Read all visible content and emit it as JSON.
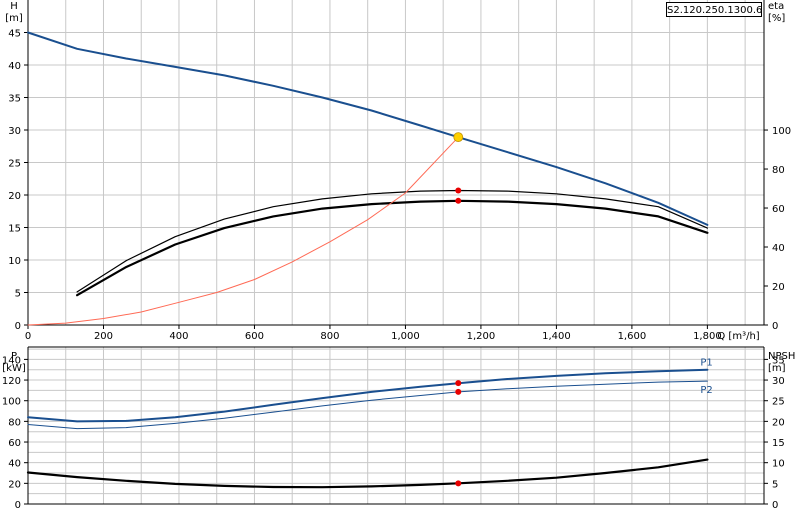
{
  "pump_label": "S2.120.250.1300.6.",
  "colors": {
    "curve_blue": "#1a4f8f",
    "red_curve": "#ff6a55",
    "grid": "#c8c8c8",
    "marker_red": "#e80000",
    "marker_yellow": "#ffd000"
  },
  "chart_data": [
    {
      "type": "line",
      "id": "head-efficiency",
      "ylabel_left": [
        "H",
        "[m]"
      ],
      "ylabel_right": [
        "eta",
        "[%]"
      ],
      "xlabel": "Q [m³/h]",
      "xlim": [
        0,
        1950
      ],
      "ylim_left": [
        0,
        50
      ],
      "ylim_right": [
        0,
        166.7
      ],
      "x_ticks": [
        0,
        200,
        400,
        600,
        800,
        1000,
        1200,
        1400,
        1600,
        1800
      ],
      "x_tick_labels": [
        "0",
        "200",
        "400",
        "600",
        "800",
        "1,000",
        "1,200",
        "1,400",
        "1,600",
        "1,800"
      ],
      "y_ticks_left": [
        0,
        5,
        10,
        15,
        20,
        25,
        30,
        35,
        40,
        45
      ],
      "y_ticks_right": [
        0,
        20,
        40,
        60,
        80,
        100
      ],
      "grid": true,
      "series": [
        {
          "axis": "left",
          "color": "#1a4f8f",
          "width": 2,
          "x": [
            0,
            130,
            260,
            390,
            520,
            650,
            780,
            910,
            1040,
            1140,
            1270,
            1400,
            1530,
            1670,
            1800
          ],
          "y": [
            45,
            42.5,
            41,
            39.7,
            38.4,
            36.8,
            35,
            33,
            30.7,
            28.9,
            26.6,
            24.3,
            21.8,
            18.8,
            15.4
          ]
        },
        {
          "axis": "right",
          "color": "#000000",
          "width": 1.2,
          "x": [
            130,
            260,
            390,
            520,
            650,
            780,
            910,
            1040,
            1140,
            1270,
            1400,
            1530,
            1670,
            1800
          ],
          "y": [
            17,
            33,
            45.3,
            54.3,
            60.7,
            64.7,
            67.3,
            68.7,
            69,
            68.7,
            67.3,
            64.7,
            60.7,
            49.7
          ]
        },
        {
          "axis": "right",
          "color": "#000000",
          "width": 2.2,
          "x": [
            130,
            260,
            390,
            520,
            650,
            780,
            910,
            1040,
            1140,
            1270,
            1400,
            1530,
            1670,
            1800
          ],
          "y": [
            15.3,
            29.7,
            41.3,
            49.7,
            55.7,
            59.7,
            62,
            63.3,
            63.7,
            63.3,
            62,
            59.7,
            55.7,
            47.3
          ]
        },
        {
          "axis": "left",
          "color": "#ff6a55",
          "width": 1,
          "x": [
            0,
            100,
            200,
            300,
            400,
            500,
            600,
            700,
            800,
            900,
            1000,
            1140
          ],
          "y": [
            0,
            0.3,
            1.0,
            2.0,
            3.5,
            5.0,
            7.0,
            9.7,
            12.8,
            16.2,
            20.3,
            28.9
          ]
        }
      ],
      "points": [
        {
          "axis": "left",
          "x": 1140,
          "y": 28.9,
          "color": "#ffd000",
          "r": 4.5
        },
        {
          "axis": "right",
          "x": 1140,
          "y": 69,
          "color": "#e80000",
          "r": 3
        },
        {
          "axis": "right",
          "x": 1140,
          "y": 63.7,
          "color": "#e80000",
          "r": 3
        }
      ]
    },
    {
      "type": "line",
      "id": "power-npsh",
      "ylabel_left": [
        "P",
        "[kW]"
      ],
      "ylabel_right": [
        "NPSH",
        "[m]"
      ],
      "xlim": [
        0,
        1950
      ],
      "ylim_left": [
        0,
        152
      ],
      "ylim_right": [
        0,
        38
      ],
      "y_ticks_left": [
        0,
        20,
        40,
        60,
        80,
        100,
        120,
        140
      ],
      "y_ticks_right": [
        0,
        5,
        10,
        15,
        20,
        25,
        30,
        35
      ],
      "grid": true,
      "series": [
        {
          "name": "P1",
          "axis": "left",
          "color": "#1a4f8f",
          "width": 2,
          "x": [
            0,
            130,
            260,
            390,
            520,
            650,
            780,
            910,
            1040,
            1140,
            1270,
            1400,
            1530,
            1670,
            1800
          ],
          "y": [
            84,
            80,
            80.5,
            84,
            89.5,
            96,
            102.5,
            108.5,
            113.5,
            117,
            121,
            124,
            126.5,
            128.5,
            130
          ]
        },
        {
          "name": "P2",
          "axis": "left",
          "color": "#1a4f8f",
          "width": 1,
          "x": [
            0,
            130,
            260,
            390,
            520,
            650,
            780,
            910,
            1040,
            1140,
            1270,
            1400,
            1530,
            1670,
            1800
          ],
          "y": [
            77,
            73,
            74,
            78,
            83,
            89,
            95,
            100.5,
            105,
            108.5,
            111.5,
            114,
            116,
            118,
            119
          ]
        },
        {
          "axis": "left",
          "color": "#000000",
          "width": 2.2,
          "x": [
            0,
            130,
            260,
            390,
            520,
            650,
            780,
            910,
            1040,
            1140,
            1270,
            1400,
            1530,
            1670,
            1800
          ],
          "y": [
            30.5,
            26,
            22.5,
            19.5,
            17.5,
            16.5,
            16.3,
            17,
            18.5,
            20,
            22.5,
            25.5,
            30,
            35.5,
            43
          ]
        }
      ],
      "points": [
        {
          "axis": "left",
          "x": 1140,
          "y": 117,
          "color": "#e80000",
          "r": 3
        },
        {
          "axis": "left",
          "x": 1140,
          "y": 108.5,
          "color": "#e80000",
          "r": 3
        },
        {
          "axis": "left",
          "x": 1140,
          "y": 20,
          "color": "#e80000",
          "r": 3
        }
      ]
    }
  ]
}
